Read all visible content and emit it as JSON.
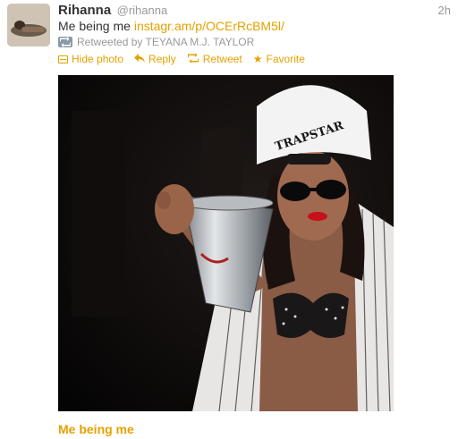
{
  "tweet": {
    "fullname": "Rihanna",
    "username": "@rihanna",
    "time": "2h",
    "text_prefix": "Me being me ",
    "link_text": "instagr.am/p/OCErRcBM5l/",
    "retweeted_by": "Retweeted by TEYANA M.J. TAYLOR",
    "actions": {
      "hide_photo": "Hide photo",
      "reply": "Reply",
      "retweet": "Retweet",
      "favorite": "Favorite"
    },
    "media_caption": "Me being me"
  },
  "colors": {
    "link": "#e6a100",
    "muted": "#999999",
    "text": "#333333"
  },
  "icons": [
    "photo-icon",
    "reply-arrow-icon",
    "retweet-icon",
    "star-icon"
  ]
}
